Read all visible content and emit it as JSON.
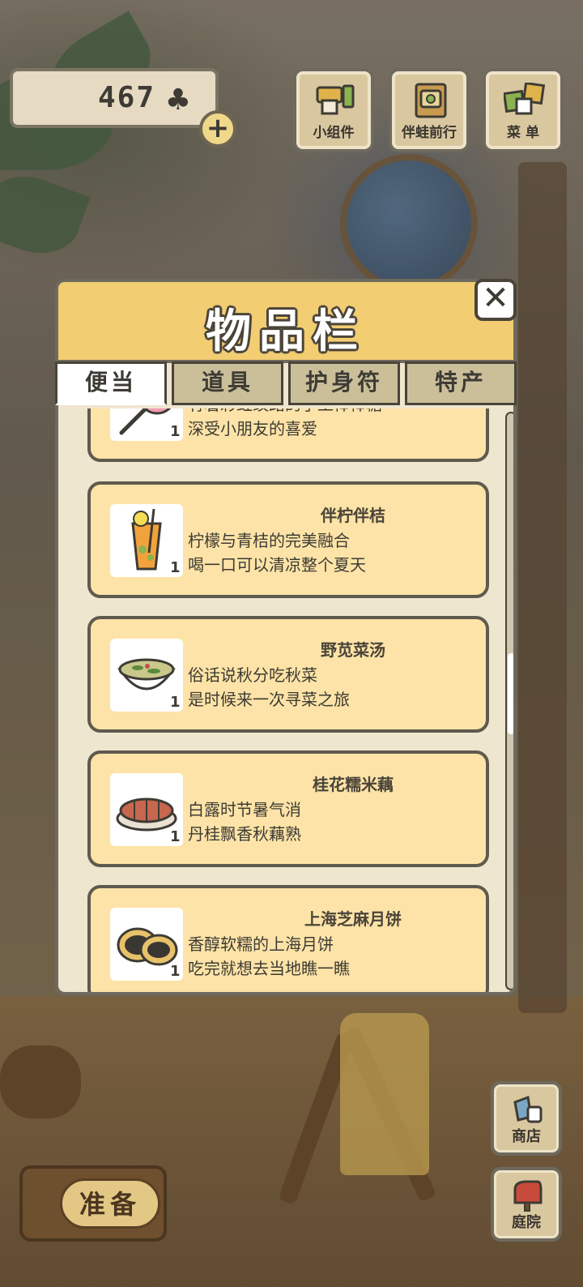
{
  "hud": {
    "clover_count": "467",
    "clover_icon": "♣",
    "plus_icon": "+",
    "buttons": [
      {
        "label": "小组件",
        "icon": "widget-icon"
      },
      {
        "label": "伴蛙前行",
        "icon": "journey-icon"
      },
      {
        "label": "菜 单",
        "icon": "menu-icon"
      }
    ]
  },
  "side": {
    "shop": "商店",
    "garden": "庭院"
  },
  "ready": {
    "label": "准备"
  },
  "panel": {
    "title": "物品栏",
    "close": "✕",
    "tabs": [
      "便当",
      "道具",
      "护身符",
      "特产"
    ],
    "active_tab": "便当",
    "items": [
      {
        "name": "",
        "desc1": "有着彩虹纹路的手工棒棒糖",
        "desc2": "深受小朋友的喜爱",
        "qty": "1",
        "icon": "lollipop-icon"
      },
      {
        "name": "伴柠伴桔",
        "desc1": "柠檬与青桔的完美融合",
        "desc2": "喝一口可以清凉整个夏天",
        "qty": "1",
        "icon": "lemon-drink-icon"
      },
      {
        "name": "野苋菜汤",
        "desc1": "俗话说秋分吃秋菜",
        "desc2": "是时候来一次寻菜之旅",
        "qty": "1",
        "icon": "vegetable-soup-icon"
      },
      {
        "name": "桂花糯米藕",
        "desc1": "白露时节暑气消",
        "desc2": "丹桂飘香秋藕熟",
        "qty": "1",
        "icon": "lotus-root-icon"
      },
      {
        "name": "上海芝麻月饼",
        "desc1": "香醇软糯的上海月饼",
        "desc2": "吃完就想去当地瞧一瞧",
        "qty": "1",
        "icon": "mooncake-icon"
      }
    ]
  },
  "colors": {
    "panel_header": "#f2cd72",
    "card": "#fde3a7",
    "border": "#5f5a4e"
  }
}
